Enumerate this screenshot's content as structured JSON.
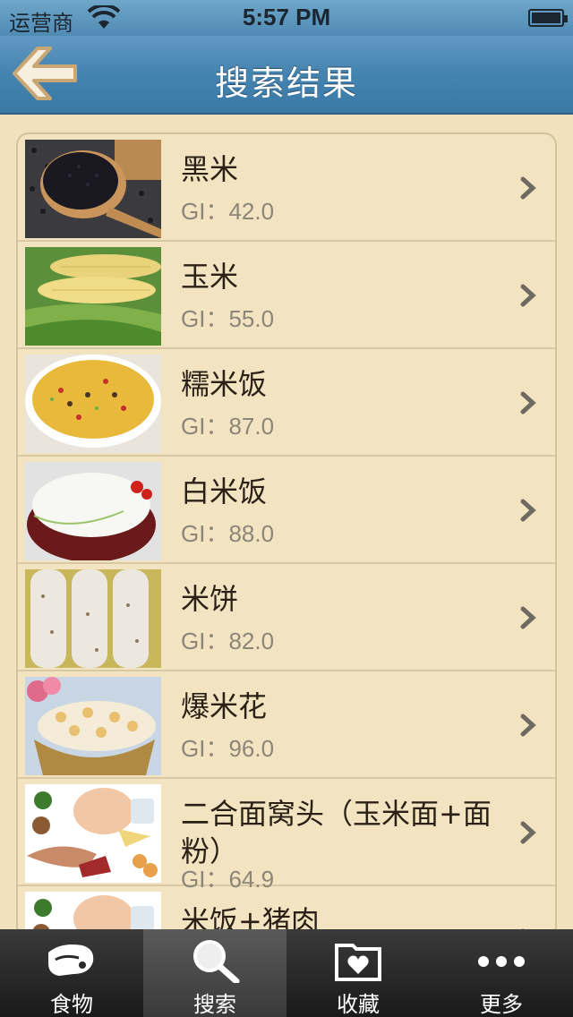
{
  "status_bar": {
    "carrier": "运营商",
    "time": "5:57 PM"
  },
  "nav": {
    "title": "搜索结果",
    "back_icon": "back-arrow-icon"
  },
  "results": [
    {
      "name": "黑米",
      "gi": "GI：42.0",
      "image": "black-rice-photo"
    },
    {
      "name": "玉米",
      "gi": "GI：55.0",
      "image": "corn-photo"
    },
    {
      "name": "糯米饭",
      "gi": "GI：87.0",
      "image": "glutinous-rice-photo"
    },
    {
      "name": "白米饭",
      "gi": "GI：88.0",
      "image": "white-rice-photo"
    },
    {
      "name": "米饼",
      "gi": "GI：82.0",
      "image": "rice-cake-photo"
    },
    {
      "name": "爆米花",
      "gi": "GI：96.0",
      "image": "popcorn-photo"
    },
    {
      "name": "二合面窝头（玉米面+面粉）",
      "gi": "GI：64.9",
      "image": "mixed-food-photo"
    },
    {
      "name": "米饭+猪肉",
      "gi": "",
      "image": "mixed-food-photo"
    }
  ],
  "tabs": [
    {
      "label": "食物",
      "icon": "meat-icon",
      "active": false
    },
    {
      "label": "搜索",
      "icon": "search-icon",
      "active": true
    },
    {
      "label": "收藏",
      "icon": "favorite-folder-icon",
      "active": false
    },
    {
      "label": "更多",
      "icon": "more-dots-icon",
      "active": false
    }
  ],
  "colors": {
    "nav_blue": "#4583b0",
    "background": "#f1e2bd",
    "tab_bar": "#2a2a2a"
  }
}
